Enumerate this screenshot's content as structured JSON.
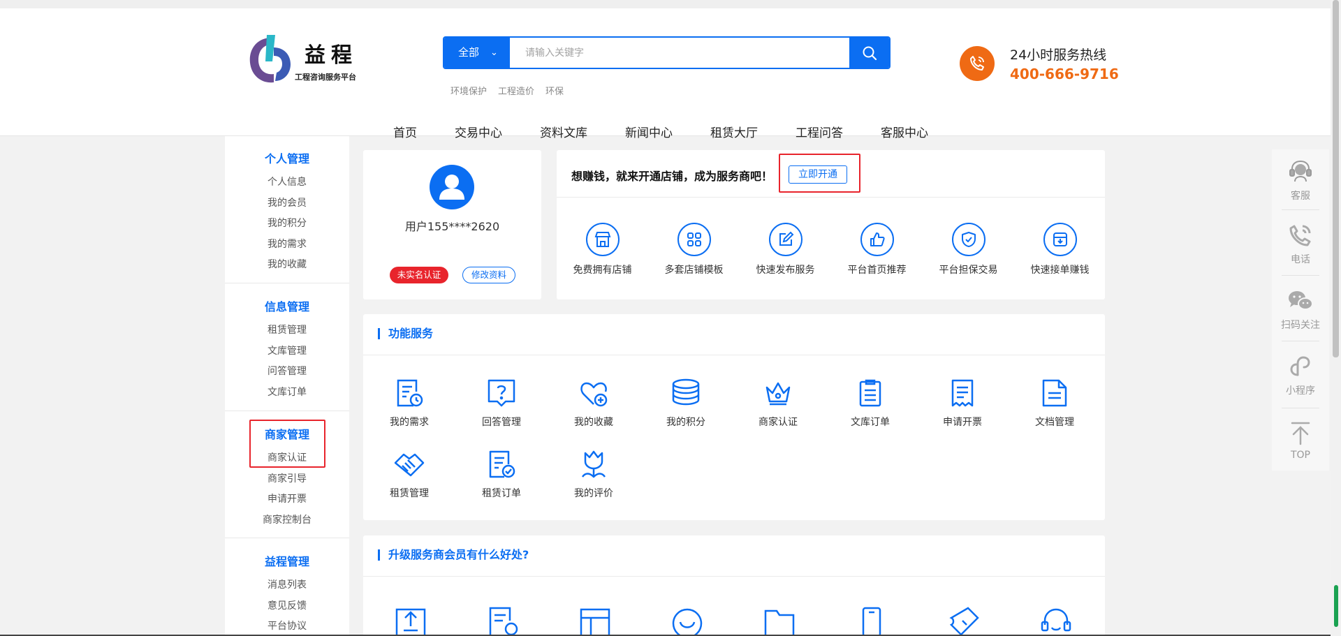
{
  "brand": {
    "name": "益程",
    "subtitle": "工程咨询服务平台"
  },
  "search": {
    "category": "全部",
    "placeholder": "请输入关键字",
    "hot_keywords": [
      "环境保护",
      "工程造价",
      "环保"
    ]
  },
  "hotline": {
    "label": "24小时服务热线",
    "number": "400-666-9716"
  },
  "nav": [
    "首页",
    "交易中心",
    "资料文库",
    "新闻中心",
    "租赁大厅",
    "工程问答",
    "客服中心"
  ],
  "sidebar": [
    {
      "title": "个人管理",
      "items": [
        "个人信息",
        "我的会员",
        "我的积分",
        "我的需求",
        "我的收藏"
      ]
    },
    {
      "title": "信息管理",
      "items": [
        "租赁管理",
        "文库管理",
        "问答管理",
        "文库订单"
      ]
    },
    {
      "title": "商家管理",
      "items": [
        "商家认证",
        "商家引导",
        "申请开票",
        "商家控制台"
      ]
    },
    {
      "title": "益程管理",
      "items": [
        "消息列表",
        "意见反馈",
        "平台协议"
      ]
    }
  ],
  "profile": {
    "username": "用户155****2620",
    "verify_status": "未实名认证",
    "edit_label": "修改资料"
  },
  "promo": {
    "text": "想赚钱，就来开通店铺，成为服务商吧！",
    "button": "立即开通",
    "perks": [
      "免费拥有店铺",
      "多套店铺模板",
      "快速发布服务",
      "平台首页推荐",
      "平台担保交易",
      "快速接单赚钱"
    ]
  },
  "services": {
    "title": "功能服务",
    "items": [
      "我的需求",
      "回答管理",
      "我的收藏",
      "我的积分",
      "商家认证",
      "文库订单",
      "申请开票",
      "文档管理",
      "租赁管理",
      "租赁订单",
      "我的评价"
    ]
  },
  "upgrade": {
    "title": "升级服务商会员有什么好处?"
  },
  "rail": [
    "客服",
    "电话",
    "扫码关注",
    "小程序",
    "TOP"
  ],
  "colors": {
    "primary": "#0b6ef2",
    "accent": "#ef6a14",
    "danger": "#e8242c"
  }
}
